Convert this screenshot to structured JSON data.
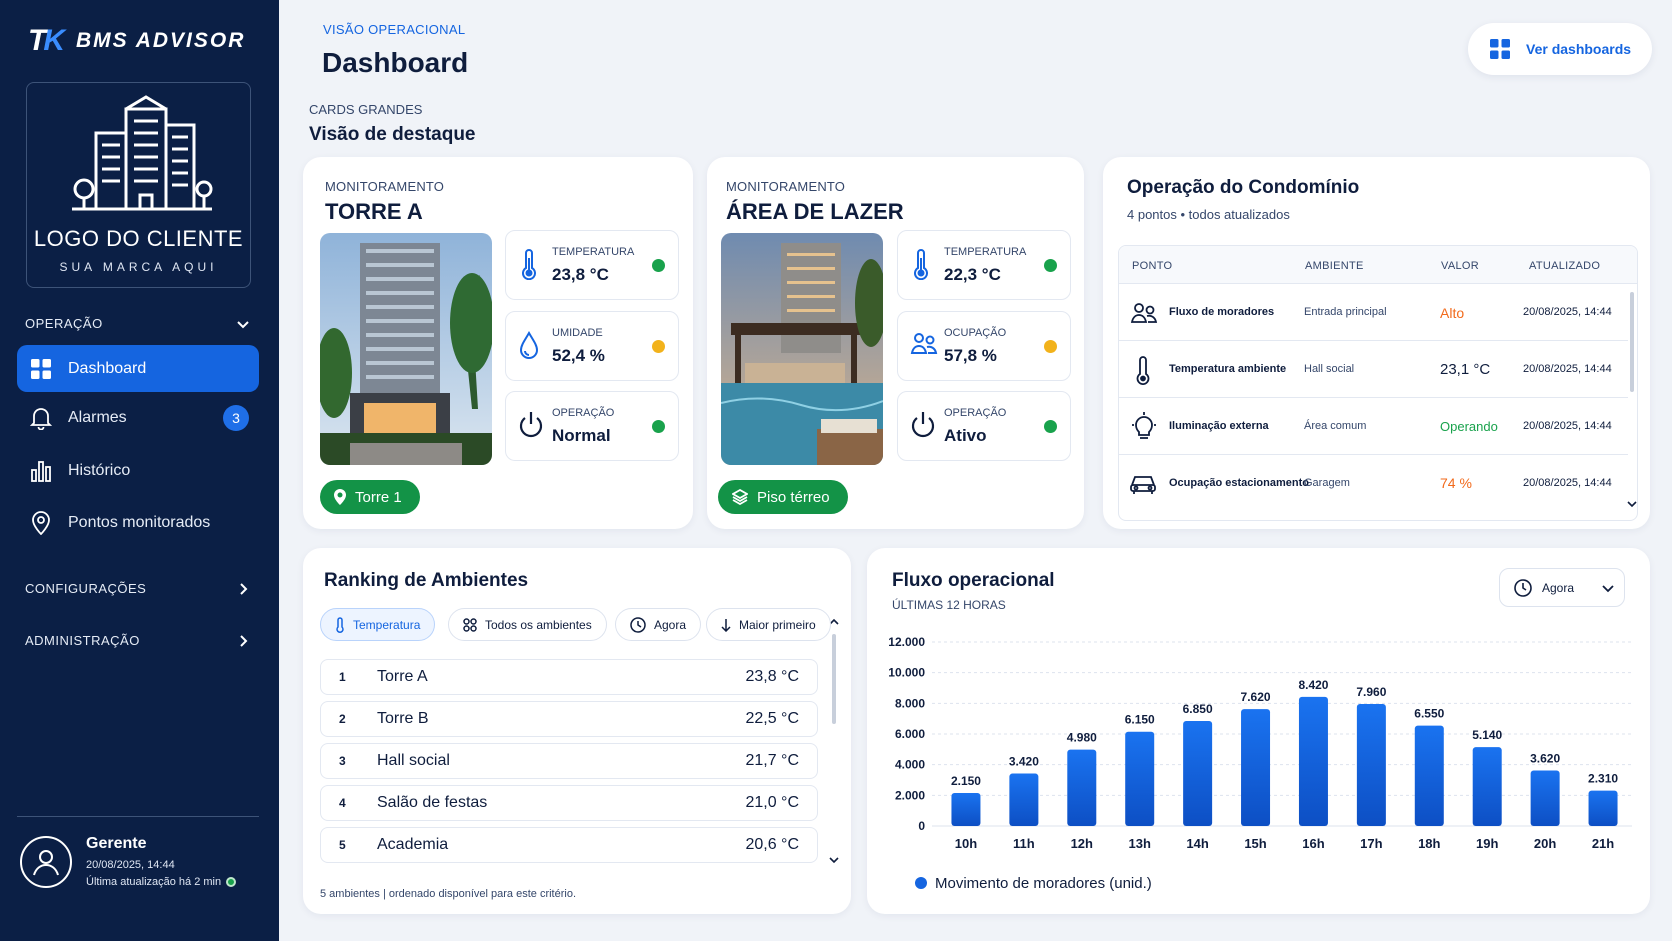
{
  "brand": {
    "mark": "TK",
    "name": "BMS ADVISOR"
  },
  "logo": {
    "title": "LOGO DO CLIENTE",
    "subtitle": "SUA MARCA AQUI"
  },
  "nav": {
    "section_operacao": "OPERAÇÃO",
    "items": [
      {
        "label": "Dashboard",
        "icon": "grid-icon",
        "active": true
      },
      {
        "label": "Alarmes",
        "icon": "bell-icon",
        "badge": "3"
      },
      {
        "label": "Histórico",
        "icon": "bar-chart-icon"
      },
      {
        "label": "Pontos monitorados",
        "icon": "location-pin-icon"
      }
    ],
    "section_config": "CONFIGURAÇÕES",
    "section_admin": "ADMINISTRAÇÃO"
  },
  "user": {
    "name": "Gerente",
    "datetime": "20/08/2025, 14:44",
    "last_update": "Última atualização há 2 min",
    "status_color": "#19a24c"
  },
  "header": {
    "kicker": "VISÃO OPERACIONAL",
    "title": "Dashboard",
    "view_button": "Ver dashboards"
  },
  "section": {
    "kicker": "CARDS GRANDES",
    "title": "Visão de destaque"
  },
  "colors": {
    "accent": "#1565e0",
    "ok": "#19a24c",
    "warn": "#f2b21b",
    "danger": "#f26a1b",
    "sidebar": "#0b1f45"
  },
  "torre": {
    "kicker": "MONITORAMENTO",
    "title": "TORRE A",
    "metrics": [
      {
        "label": "TEMPERATURA",
        "value": "23,8 °C",
        "icon": "thermometer-icon",
        "status": "#19a24c"
      },
      {
        "label": "UMIDADE",
        "value": "52,4 %",
        "icon": "droplet-icon",
        "status": "#f2b21b"
      },
      {
        "label": "OPERAÇÃO",
        "value": "Normal",
        "icon": "power-icon",
        "status": "#19a24c"
      }
    ],
    "pill": "Torre 1"
  },
  "lazer": {
    "kicker": "MONITORAMENTO",
    "title": "ÁREA DE LAZER",
    "metrics": [
      {
        "label": "TEMPERATURA",
        "value": "22,3 °C",
        "icon": "thermometer-icon",
        "status": "#19a24c"
      },
      {
        "label": "OCUPAÇÃO",
        "value": "57,8 %",
        "icon": "people-icon",
        "status": "#f2b21b"
      },
      {
        "label": "OPERAÇÃO",
        "value": "Ativo",
        "icon": "power-icon",
        "status": "#19a24c"
      }
    ],
    "pill": "Piso térreo"
  },
  "operacao": {
    "title": "Operação do Condomínio",
    "subtitle": "4 pontos • todos atualizados",
    "headers": [
      "PONTO",
      "AMBIENTE",
      "VALOR",
      "ATUALIZADO"
    ],
    "rows": [
      {
        "icon": "people-icon",
        "ponto": "Fluxo de moradores",
        "ambiente": "Entrada principal",
        "valor": "Alto",
        "valor_color": "#f26a1b",
        "atualizado": "20/08/2025, 14:44"
      },
      {
        "icon": "thermometer-icon",
        "ponto": "Temperatura ambiente",
        "ambiente": "Hall social",
        "valor": "23,1 °C",
        "valor_color": "#0f1d3d",
        "atualizado": "20/08/2025, 14:44"
      },
      {
        "icon": "lightbulb-icon",
        "ponto": "Iluminação externa",
        "ambiente": "Área comum",
        "valor": "Operando",
        "valor_color": "#19a24c",
        "atualizado": "20/08/2025, 14:44"
      },
      {
        "icon": "car-icon",
        "ponto": "Ocupação estacionamento",
        "ambiente": "Garagem",
        "valor": "74 %",
        "valor_color": "#f26a1b",
        "atualizado": "20/08/2025, 14:44"
      }
    ]
  },
  "ranking": {
    "title": "Ranking de Ambientes",
    "filters": [
      "Temperatura",
      "Todos os ambientes",
      "Agora",
      "Maior primeiro"
    ],
    "items": [
      {
        "rank": "1",
        "name": "Torre A",
        "value": "23,8 °C"
      },
      {
        "rank": "2",
        "name": "Torre B",
        "value": "22,5 °C"
      },
      {
        "rank": "3",
        "name": "Hall social",
        "value": "21,7 °C"
      },
      {
        "rank": "4",
        "name": "Salão de festas",
        "value": "21,0 °C"
      },
      {
        "rank": "5",
        "name": "Academia",
        "value": "20,6 °C"
      }
    ],
    "footer": "5 ambientes | ordenado disponível para este critério."
  },
  "fluxo": {
    "title": "Fluxo operacional",
    "subtitle": "ÚLTIMAS 12 HORAS",
    "dropdown": "Agora"
  },
  "chart_data": {
    "type": "bar",
    "title": "Fluxo operacional",
    "categories": [
      "10h",
      "11h",
      "12h",
      "13h",
      "14h",
      "15h",
      "16h",
      "17h",
      "18h",
      "19h",
      "20h",
      "21h"
    ],
    "series": [
      {
        "name": "Movimento de moradores (unid.)",
        "values": [
          2150,
          3420,
          4980,
          6150,
          6850,
          7620,
          8420,
          7960,
          6550,
          5140,
          3620,
          2310
        ],
        "color": "#1565e0"
      }
    ],
    "value_labels": [
      "2.150",
      "3.420",
      "4.980",
      "6.150",
      "6.850",
      "7.620",
      "8.420",
      "7.960",
      "6.550",
      "5.140",
      "3.620",
      "2.310"
    ],
    "yticks": [
      "0",
      "2.000",
      "4.000",
      "6.000",
      "8.000",
      "10.000",
      "12.000"
    ],
    "ylim": [
      0,
      12000
    ],
    "grid": true,
    "legend_position": "bottom-left"
  }
}
